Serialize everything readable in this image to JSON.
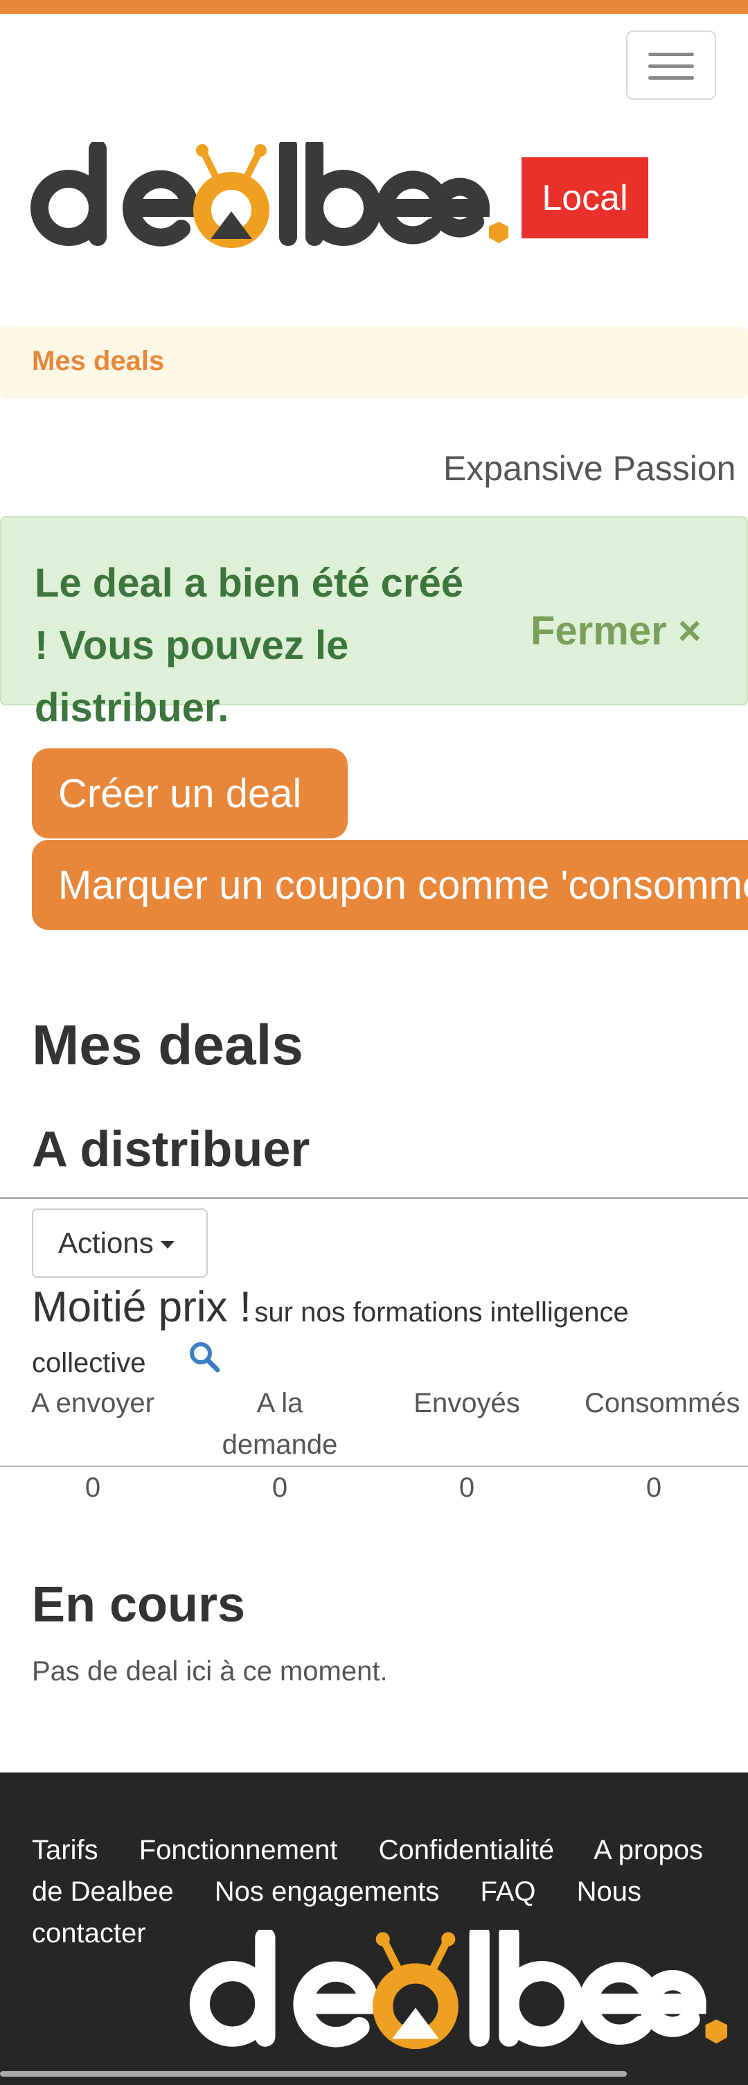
{
  "header": {
    "menu_label": "Menu",
    "logo_text": "dealbee",
    "badge": "Local"
  },
  "breadcrumb": {
    "label": "Mes deals"
  },
  "user": {
    "name": "Expansive Passion"
  },
  "alert": {
    "message": "Le deal a bien été créé ! Vous pouvez le distribuer.",
    "close_label": "Fermer ×"
  },
  "buttons": {
    "create": "Créer un deal",
    "mark_coupon": "Marquer un coupon comme 'consommé'"
  },
  "main": {
    "title": "Mes deals",
    "section_distribute": "A distribuer",
    "actions_label": "Actions",
    "deal": {
      "title": "Moitié prix !",
      "subtitle": "sur nos formations intelligence collective"
    },
    "table": {
      "headers": [
        "A envoyer",
        "A la demande",
        "Envoyés",
        "Consommés"
      ],
      "values": [
        "0",
        "0",
        "0",
        "0"
      ]
    },
    "section_current": "En cours",
    "empty_text": "Pas de deal ici à ce moment."
  },
  "footer": {
    "links": [
      "Tarifs",
      "Fonctionnement",
      "Confidentialité",
      "A propos de Dealbee",
      "Nos engagements",
      "FAQ",
      "Nous contacter"
    ]
  },
  "colors": {
    "brand_orange": "#e8873a",
    "badge_red": "#e9302a",
    "success_text": "#3c763d",
    "success_bg": "#dff0d8",
    "footer_bg": "#262626"
  }
}
